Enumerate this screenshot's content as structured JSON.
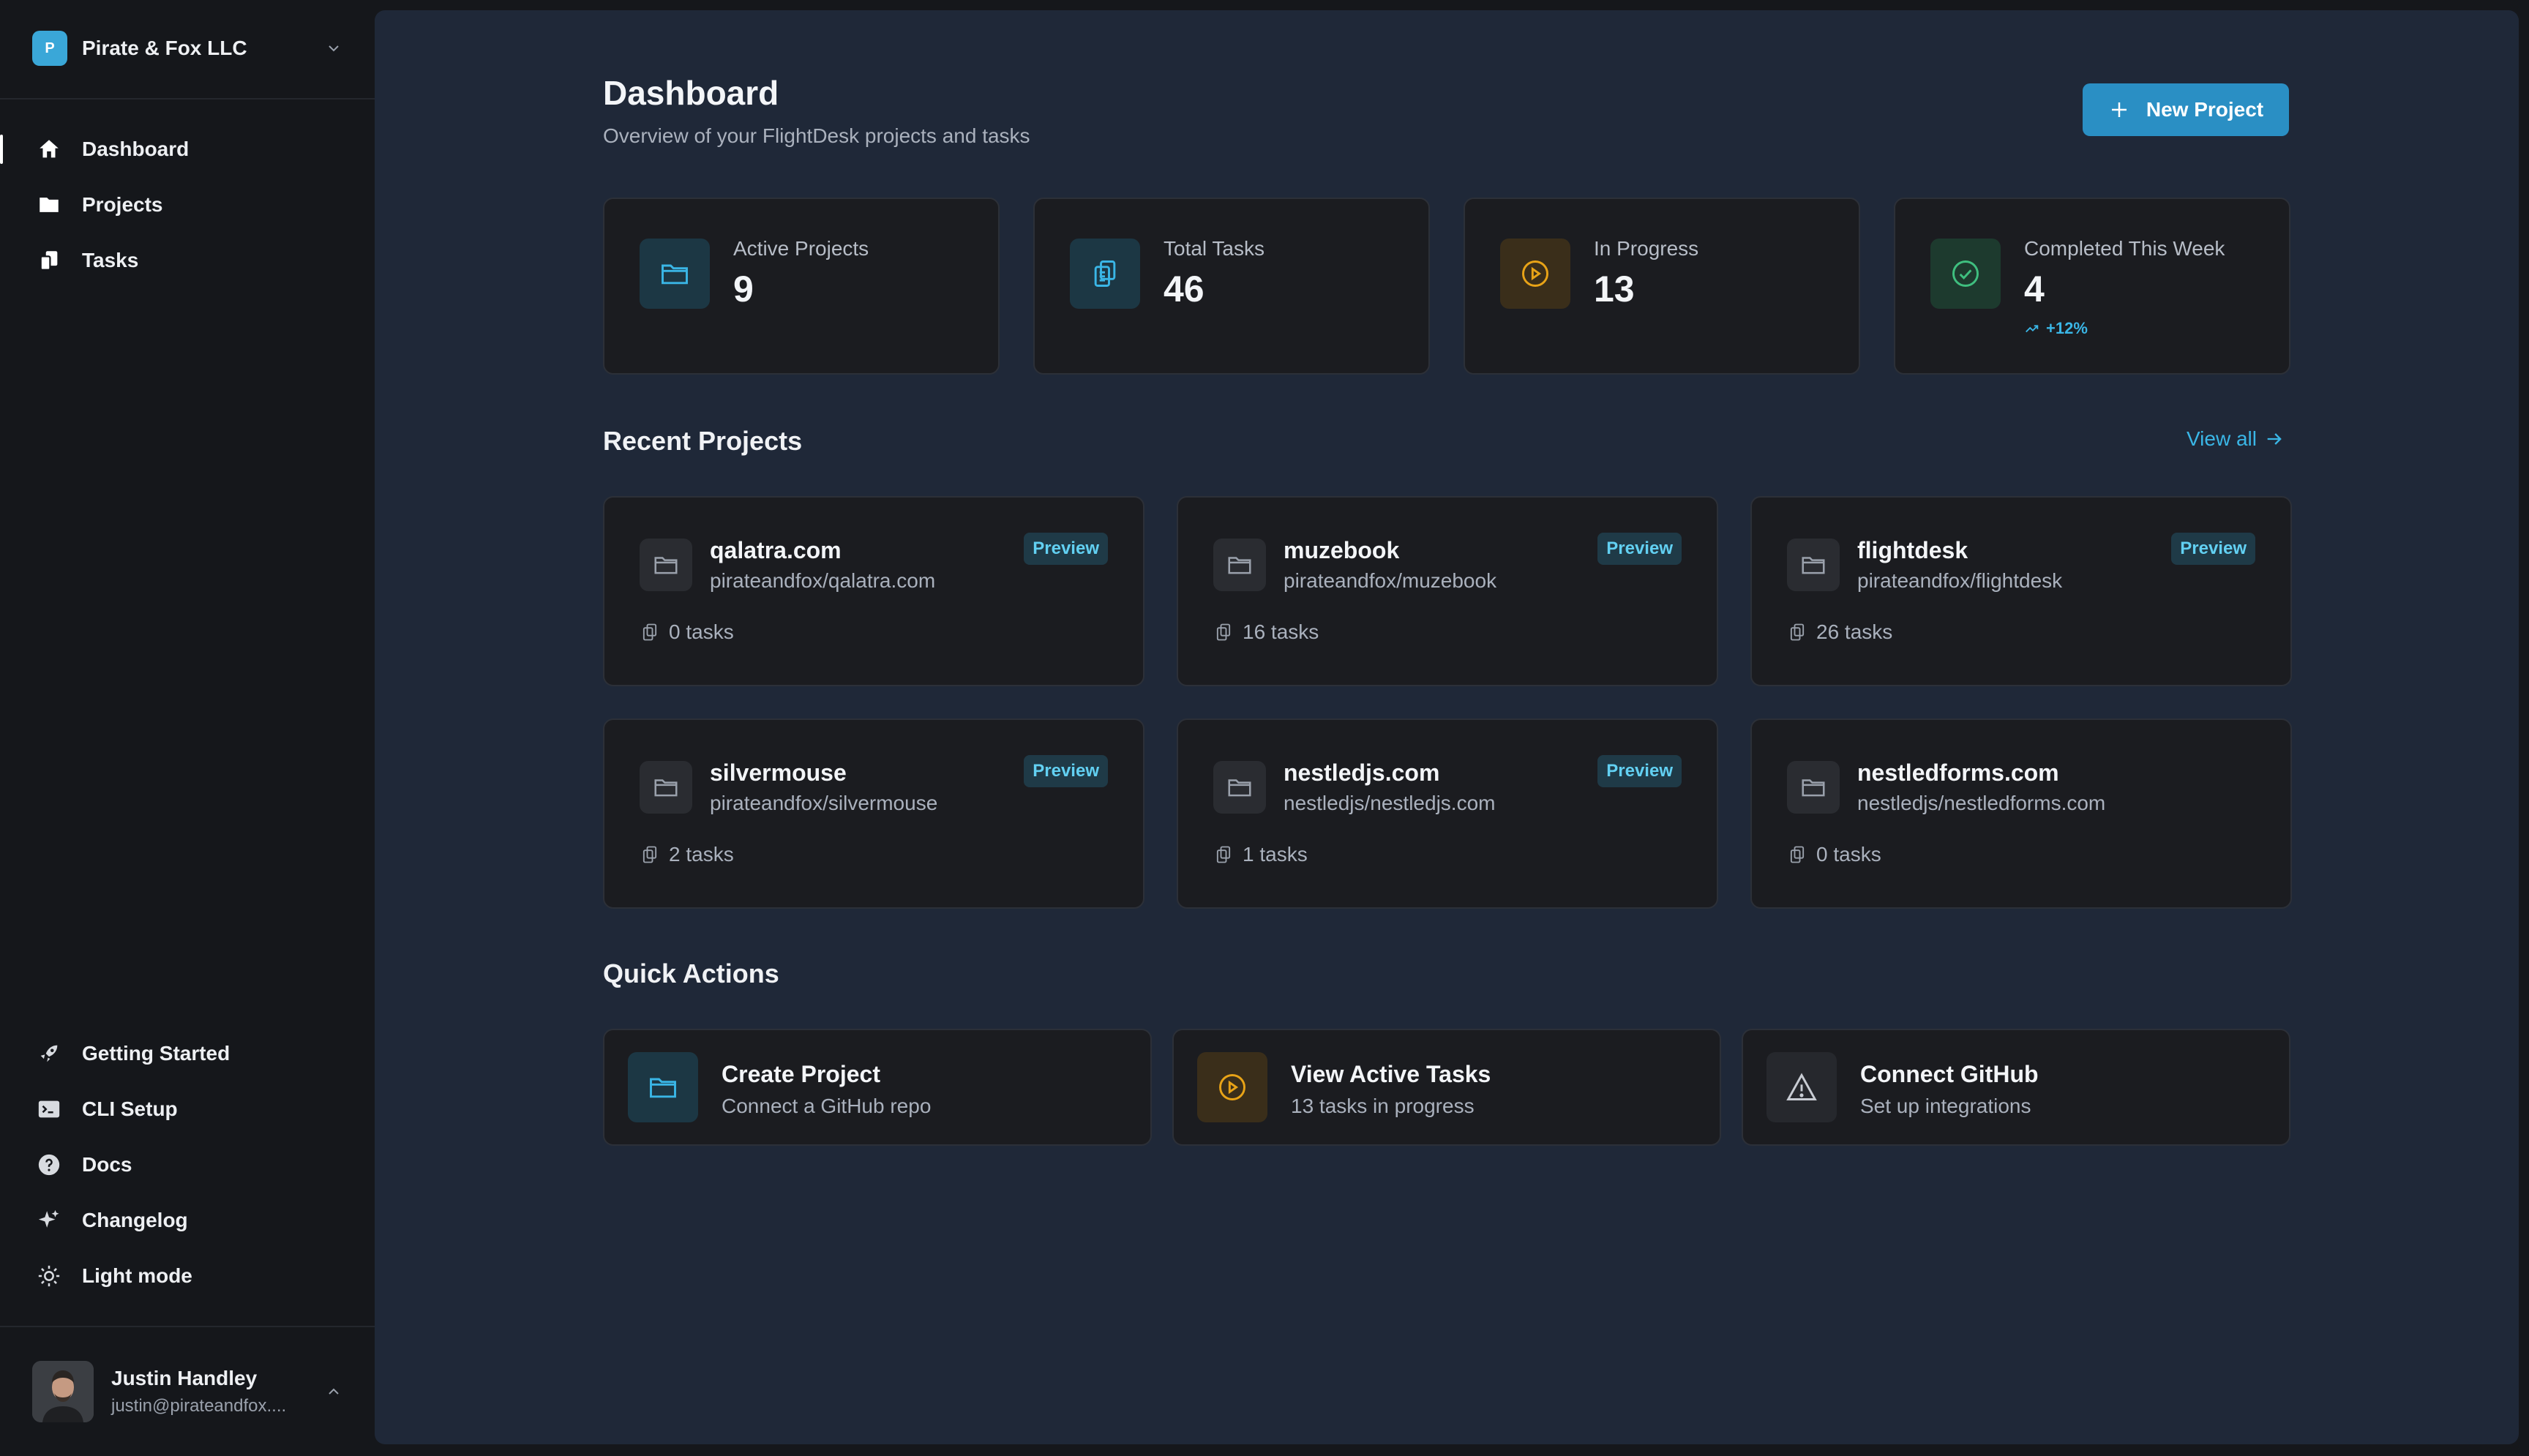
{
  "org": {
    "initial": "P",
    "name": "Pirate & Fox LLC"
  },
  "nav_primary": [
    {
      "label": "Dashboard",
      "icon": "home-icon",
      "active": true
    },
    {
      "label": "Projects",
      "icon": "folder-icon"
    },
    {
      "label": "Tasks",
      "icon": "tasks-icon"
    }
  ],
  "nav_secondary": [
    {
      "label": "Getting Started",
      "icon": "rocket-icon"
    },
    {
      "label": "CLI Setup",
      "icon": "terminal-icon"
    },
    {
      "label": "Docs",
      "icon": "help-circle-icon"
    },
    {
      "label": "Changelog",
      "icon": "sparkles-icon"
    },
    {
      "label": "Light mode",
      "icon": "sun-icon"
    }
  ],
  "user": {
    "name": "Justin Handley",
    "email": "justin@pirateandfox...."
  },
  "header": {
    "title": "Dashboard",
    "subtitle": "Overview of your FlightDesk projects and tasks",
    "new_project_label": "New Project"
  },
  "stats": [
    {
      "label": "Active Projects",
      "value": "9",
      "icon": "folder-icon"
    },
    {
      "label": "Total Tasks",
      "value": "46",
      "icon": "clipboard-icon"
    },
    {
      "label": "In Progress",
      "value": "13",
      "icon": "play-circle-icon"
    },
    {
      "label": "Completed This Week",
      "value": "4",
      "icon": "check-circle-icon",
      "trend": "+12%"
    }
  ],
  "recent": {
    "title": "Recent Projects",
    "view_all": "View all",
    "projects": [
      {
        "name": "qalatra.com",
        "repo": "pirateandfox/qalatra.com",
        "tasks": "0 tasks",
        "badge": "Preview"
      },
      {
        "name": "muzebook",
        "repo": "pirateandfox/muzebook",
        "tasks": "16 tasks",
        "badge": "Preview"
      },
      {
        "name": "flightdesk",
        "repo": "pirateandfox/flightdesk",
        "tasks": "26 tasks",
        "badge": "Preview"
      },
      {
        "name": "silvermouse",
        "repo": "pirateandfox/silvermouse",
        "tasks": "2 tasks",
        "badge": "Preview"
      },
      {
        "name": "nestledjs.com",
        "repo": "nestledjs/nestledjs.com",
        "tasks": "1 tasks",
        "badge": "Preview"
      },
      {
        "name": "nestledforms.com",
        "repo": "nestledjs/nestledforms.com",
        "tasks": "0 tasks",
        "badge": ""
      }
    ]
  },
  "quick_actions": {
    "title": "Quick Actions",
    "items": [
      {
        "title": "Create Project",
        "subtitle": "Connect a GitHub repo",
        "icon": "folder-icon"
      },
      {
        "title": "View Active Tasks",
        "subtitle": "13 tasks in progress",
        "icon": "play-circle-icon"
      },
      {
        "title": "Connect GitHub",
        "subtitle": "Set up integrations",
        "icon": "alert-triangle-icon"
      }
    ]
  },
  "colors": {
    "accent": "#2a8fc4",
    "link": "#3ab6e6",
    "amber": "#e8a317",
    "green": "#3fbf7f",
    "main_bg": "#1f2838",
    "card_bg": "#1b1c20"
  }
}
